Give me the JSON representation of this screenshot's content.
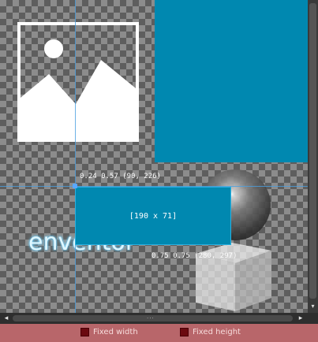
{
  "canvas": {
    "brand_text": "enventor",
    "selection_size": "[190 x 71]",
    "coord_start": "0.24 0.57 (90, 226)",
    "coord_end": "0.75 0.75 (280, 297)",
    "accent_color": "#0088b0"
  },
  "scrollbar": {
    "grip": "...",
    "left_arrow": "◂",
    "right_arrow": "▸",
    "down_arrow": "▾"
  },
  "bottom_bar": {
    "fixed_width_label": "Fixed width",
    "fixed_height_label": "Fixed height"
  },
  "icons": {
    "image_placeholder": "image-icon",
    "sphere": "sphere-image",
    "cube": "cube-image"
  }
}
